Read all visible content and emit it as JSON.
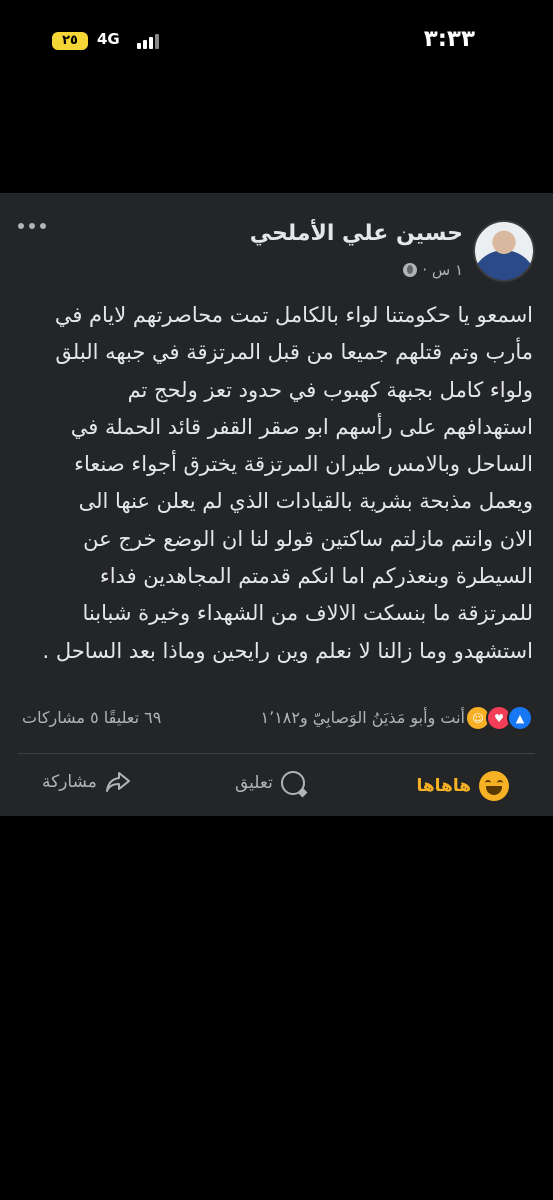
{
  "status_bar": {
    "time": "٣:٣٣",
    "network": "4G",
    "battery": "٢٥"
  },
  "post": {
    "author": "حسين علي الأملحي",
    "timestamp": "١ س ·",
    "text_lines": [
      "اسمعو يا حكومتنا لواء بالكامل تمت محاصرتهم لايام في",
      "مأرب وتم قتلهم جميعا من قبل المرتزقة في جبهه البلق",
      "ولواء كامل بجبهة كهبوب في حدود تعز ولحج تم",
      "استهدافهم على رأسهم ابو صقر القفر قائد الحملة في",
      "الساحل  وبالامس طيران المرتزقة يخترق أجواء صنعاء",
      "ويعمل مذبحة بشرية بالقيادات الذي لم يعلن عنها الى",
      "الان وانتم مازلتم ساكتين قولو لنا ان الوضع خرج عن",
      "السيطرة وبنعذركم اما انكم قدمتم المجاهدين فداء",
      "للمرتزقة ما بنسكت الالاف من الشهداء وخيرة شبابنا",
      "استشهدو وما زالنا لا نعلم وين رايحين وماذا بعد الساحل ."
    ],
    "reactions_summary": "أنت وأبو مَذيَنُ الوَصابِيّ و١٬١٨٢",
    "counts": "٦٩ تعليقًا  ٥ مشاركات",
    "actions": {
      "haha": "هاهاها",
      "comment": "تعليق",
      "share": "مشاركة"
    }
  },
  "icons": [
    "more-icon",
    "avatar",
    "globe-icon",
    "like-icon",
    "love-icon",
    "haha-icon",
    "comment-icon",
    "share-icon"
  ],
  "colors": {
    "post_background": "#242526",
    "haha_accent": "#f7b125",
    "like_blue": "#1877f2",
    "love_red": "#f33e58"
  }
}
